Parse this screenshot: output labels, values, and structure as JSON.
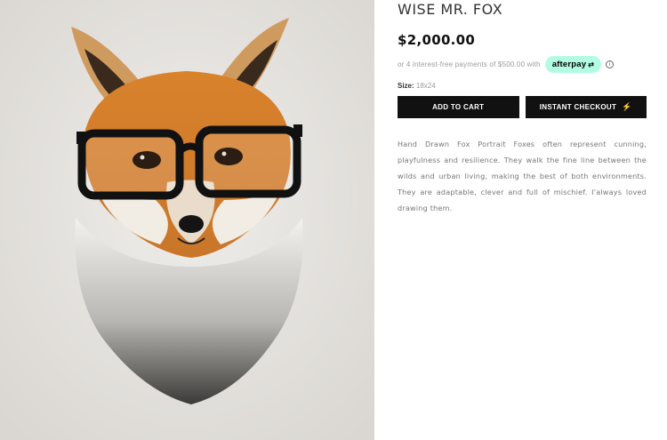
{
  "product": {
    "image_alt": "Fox portrait wearing glasses",
    "title": "WISE MR. FOX",
    "price": "$2,000.00",
    "afterpay": {
      "text": "or 4 interest-free payments of $500.00 with",
      "brand": "afterpay",
      "brand_color": "#b2fce4",
      "info_icon": "info-icon"
    },
    "size": {
      "label": "Size:",
      "value": "18x24"
    },
    "buttons": {
      "add_to_cart": "ADD TO CART",
      "instant_checkout": "INSTANT CHECKOUT"
    },
    "description": "Hand Drawn Fox Portrait Foxes often represent cunning, playfulness and resilience. They walk the fine line between the wilds and urban living, making the best of both environments. They are adaptable, clever and full of mischief. I'always loved drawing them."
  }
}
